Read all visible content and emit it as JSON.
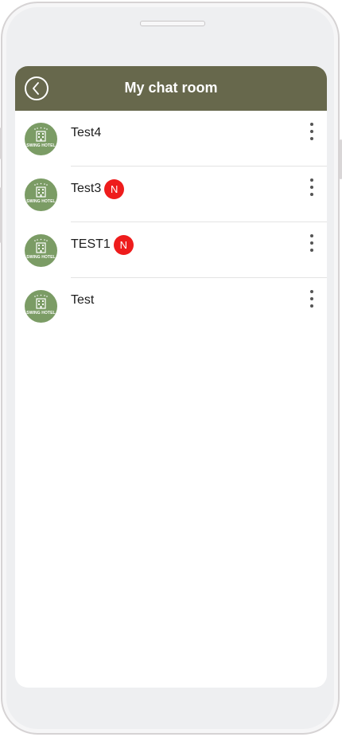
{
  "header": {
    "title": "My chat room",
    "back_icon": "chevron-left-icon",
    "color": "#67684c"
  },
  "avatar": {
    "label": "SWING HOTEL",
    "color": "#7b9c65"
  },
  "badge_color": "#ee1c1c",
  "rooms": [
    {
      "name": "Test4",
      "badge": ""
    },
    {
      "name": "Test3",
      "badge": "N"
    },
    {
      "name": "TEST1",
      "badge": "N"
    },
    {
      "name": "Test",
      "badge": ""
    }
  ]
}
